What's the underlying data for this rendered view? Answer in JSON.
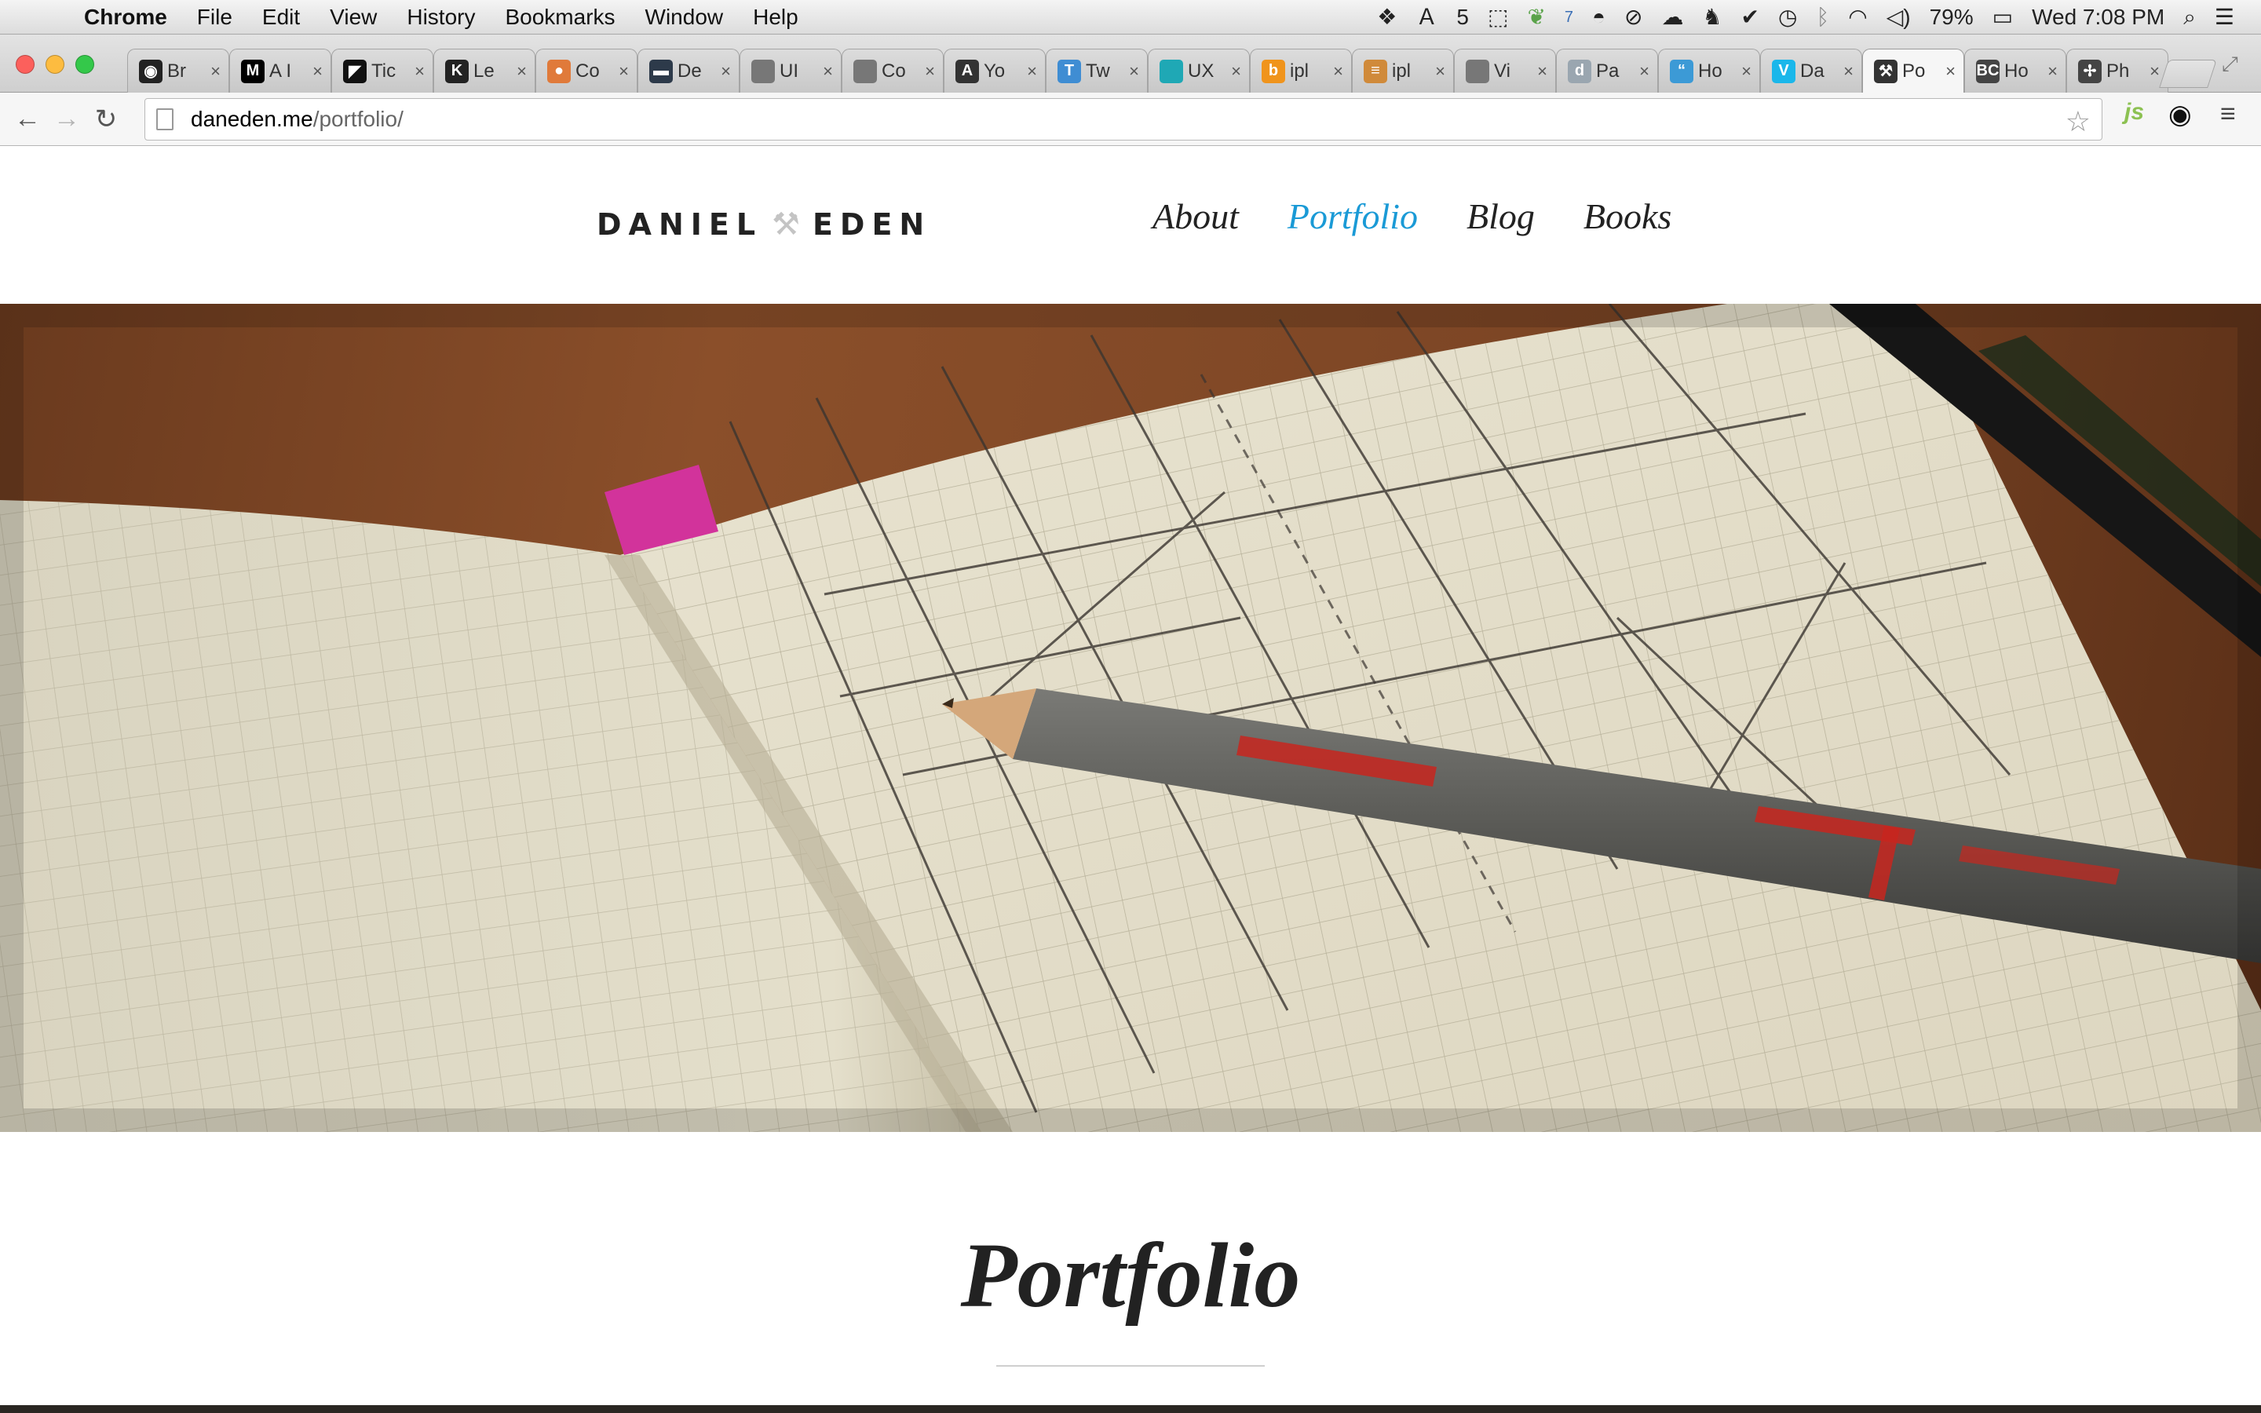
{
  "menubar": {
    "apple_glyph": "",
    "app_name": "Chrome",
    "items": [
      "File",
      "Edit",
      "View",
      "History",
      "Bookmarks",
      "Window",
      "Help"
    ],
    "status": {
      "adobe_count": "5",
      "badge_count": "7",
      "battery": "79%",
      "clock": "Wed 7:08 PM"
    }
  },
  "tabs": [
    {
      "title": "Br",
      "favicon": "github-icon",
      "color": "#222222",
      "glyph": "◉"
    },
    {
      "title": "A I",
      "favicon": "medium-icon",
      "color": "#000000",
      "glyph": "M"
    },
    {
      "title": "Tic",
      "favicon": "ticket-icon",
      "color": "#111111",
      "glyph": "◤"
    },
    {
      "title": "Le",
      "favicon": "letter-icon",
      "color": "#222222",
      "glyph": "K"
    },
    {
      "title": "Co",
      "favicon": "hands-icon",
      "color": "#e07a3a",
      "glyph": "●"
    },
    {
      "title": "De",
      "favicon": "dark-square-icon",
      "color": "#2d3a4a",
      "glyph": "▬"
    },
    {
      "title": "UI",
      "favicon": "apple-icon",
      "color": "#777777",
      "glyph": ""
    },
    {
      "title": "Co",
      "favicon": "apple-icon",
      "color": "#777777",
      "glyph": ""
    },
    {
      "title": "Yo",
      "favicon": "a-letter-icon",
      "color": "#333333",
      "glyph": "A"
    },
    {
      "title": "Tw",
      "favicon": "typekit-icon",
      "color": "#3f8dd3",
      "glyph": "T"
    },
    {
      "title": "UX",
      "favicon": "teal-square-icon",
      "color": "#1fa8b5",
      "glyph": ""
    },
    {
      "title": "ipl",
      "favicon": "orange-b-icon",
      "color": "#f0941c",
      "glyph": "b"
    },
    {
      "title": "ipl",
      "favicon": "stack-icon",
      "color": "#d08a3a",
      "glyph": "≡"
    },
    {
      "title": "Vi",
      "favicon": "apple-icon",
      "color": "#777777",
      "glyph": ""
    },
    {
      "title": "Pa",
      "favicon": "dt-icon",
      "color": "#9aa6b0",
      "glyph": "d"
    },
    {
      "title": "Ho",
      "favicon": "quote-icon",
      "color": "#3c9ad6",
      "glyph": "“"
    },
    {
      "title": "Da",
      "favicon": "vimeo-icon",
      "color": "#1ab7ea",
      "glyph": "V"
    },
    {
      "title": "Po",
      "favicon": "hammer-icon",
      "color": "#333333",
      "glyph": "⚒",
      "active": true
    },
    {
      "title": "Ho",
      "favicon": "bc-icon",
      "color": "#444444",
      "glyph": "BC"
    },
    {
      "title": "Ph",
      "favicon": "ph-icon",
      "color": "#444444",
      "glyph": "✢"
    }
  ],
  "tab_close_glyph": "×",
  "toolbar": {
    "back_glyph": "←",
    "forward_glyph": "→",
    "reload_glyph": "↻",
    "url_host": "daneden.me",
    "url_path": "/portfolio/",
    "star_glyph": "☆",
    "ext_js": "js",
    "ext_eye": "◉",
    "menu_glyph": "≡"
  },
  "site": {
    "logo_first": "DANIEL",
    "logo_mark": "⚒",
    "logo_last": "EDEN",
    "nav": [
      "About",
      "Portfolio",
      "Blog",
      "Books"
    ],
    "current_nav": "Portfolio",
    "page_title": "Portfolio"
  },
  "colors": {
    "link_active": "#1a9ad6",
    "text": "#222222"
  }
}
